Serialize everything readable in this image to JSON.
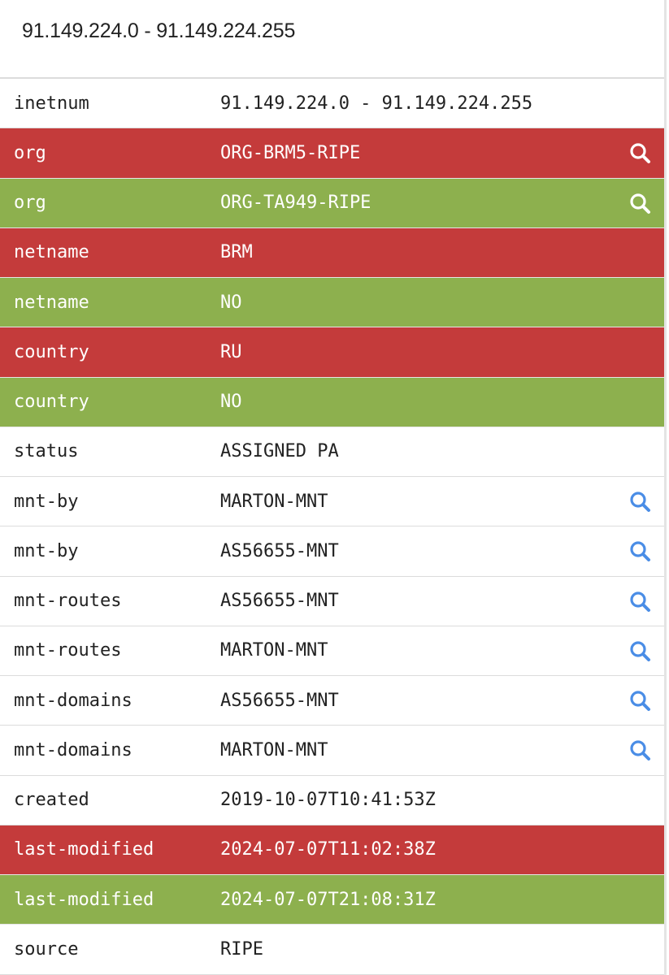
{
  "header": {
    "title": "91.149.224.0 - 91.149.224.255"
  },
  "colors": {
    "removed": "#c43b3b",
    "added": "#8db04e",
    "search_icon": "#4a8de6"
  },
  "rows": [
    {
      "attr": "inetnum",
      "value": "91.149.224.0 - 91.149.224.255",
      "state": "normal",
      "search": false
    },
    {
      "attr": "org",
      "value": "ORG-BRM5-RIPE",
      "state": "removed",
      "search": true
    },
    {
      "attr": "org",
      "value": "ORG-TA949-RIPE",
      "state": "added",
      "search": true
    },
    {
      "attr": "netname",
      "value": "BRM",
      "state": "removed",
      "search": false
    },
    {
      "attr": "netname",
      "value": "NO",
      "state": "added",
      "search": false
    },
    {
      "attr": "country",
      "value": "RU",
      "state": "removed",
      "search": false
    },
    {
      "attr": "country",
      "value": "NO",
      "state": "added",
      "search": false
    },
    {
      "attr": "status",
      "value": "ASSIGNED PA",
      "state": "normal",
      "search": false
    },
    {
      "attr": "mnt-by",
      "value": "MARTON-MNT",
      "state": "normal",
      "search": true
    },
    {
      "attr": "mnt-by",
      "value": "AS56655-MNT",
      "state": "normal",
      "search": true
    },
    {
      "attr": "mnt-routes",
      "value": "AS56655-MNT",
      "state": "normal",
      "search": true
    },
    {
      "attr": "mnt-routes",
      "value": "MARTON-MNT",
      "state": "normal",
      "search": true
    },
    {
      "attr": "mnt-domains",
      "value": "AS56655-MNT",
      "state": "normal",
      "search": true
    },
    {
      "attr": "mnt-domains",
      "value": "MARTON-MNT",
      "state": "normal",
      "search": true
    },
    {
      "attr": "created",
      "value": "2019-10-07T10:41:53Z",
      "state": "normal",
      "search": false
    },
    {
      "attr": "last-modified",
      "value": "2024-07-07T11:02:38Z",
      "state": "removed",
      "search": false
    },
    {
      "attr": "last-modified",
      "value": "2024-07-07T21:08:31Z",
      "state": "added",
      "search": false
    },
    {
      "attr": "source",
      "value": "RIPE",
      "state": "normal",
      "search": false
    }
  ]
}
